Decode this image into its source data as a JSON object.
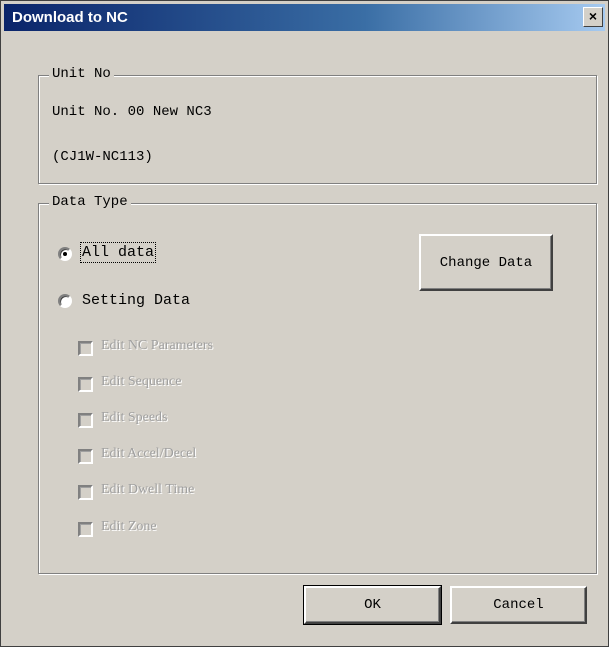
{
  "window": {
    "title": "Download to NC",
    "close_glyph": "×"
  },
  "unit_group": {
    "title": "Unit No",
    "line1": "Unit No. 00 New NC3",
    "line2": "(CJ1W-NC113)"
  },
  "data_type_group": {
    "title": "Data Type",
    "radio_all": {
      "label": "All data",
      "checked": true
    },
    "radio_setting": {
      "label": "Setting Data",
      "checked": false
    },
    "change_data_label": "Change Data",
    "checkboxes": [
      {
        "label": "Edit NC Parameters",
        "enabled": false
      },
      {
        "label": "Edit Sequence",
        "enabled": false
      },
      {
        "label": "Edit Speeds",
        "enabled": false
      },
      {
        "label": "Edit Accel/Decel",
        "enabled": false
      },
      {
        "label": "Edit Dwell Time",
        "enabled": false
      },
      {
        "label": "Edit Zone",
        "enabled": false
      }
    ]
  },
  "footer": {
    "ok_label": "OK",
    "cancel_label": "Cancel"
  },
  "colors": {
    "face": "#d4d0c8",
    "title_start": "#0a246a",
    "title_end": "#a6caf0",
    "disabled_text": "#a0a0a0"
  }
}
